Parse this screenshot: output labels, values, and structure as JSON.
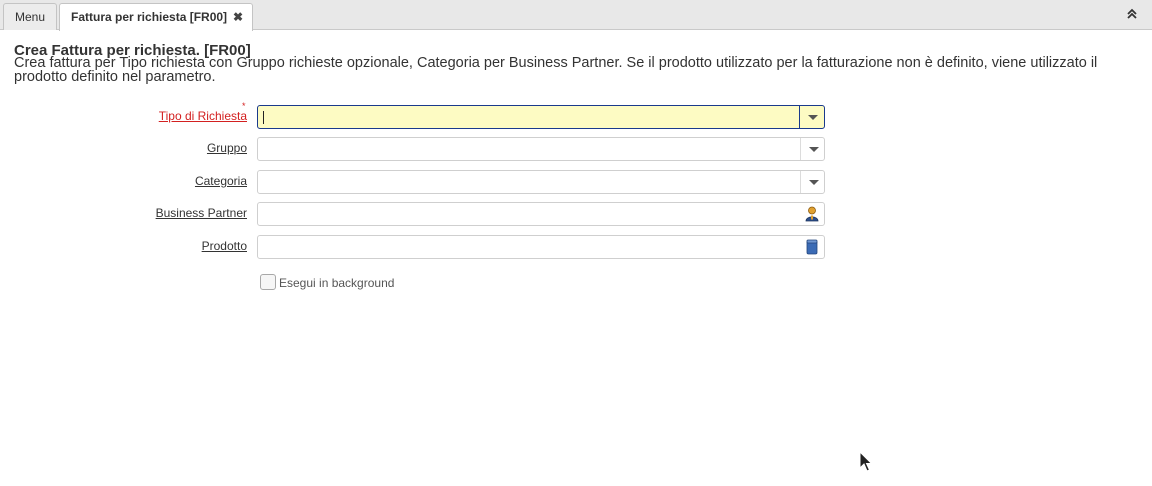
{
  "tabs": {
    "menu_label": "Menu",
    "active_label": "Fattura per richiesta [FR00]",
    "close_glyph": "✖"
  },
  "process": {
    "title": "Crea Fattura per richiesta. [FR00]",
    "description": "Crea fattura per Tipo richiesta con Gruppo richieste opzionale, Categoria per Business Partner. Se il prodotto utilizzato per la fatturazione non è definito, viene utilizzato il prodotto definito nel parametro."
  },
  "form": {
    "tipo_richiesta": {
      "label": "Tipo di Richiesta",
      "required_mark": "*",
      "value": ""
    },
    "gruppo": {
      "label": "Gruppo",
      "value": ""
    },
    "categoria": {
      "label": "Categoria",
      "value": ""
    },
    "business_partner": {
      "label": "Business Partner",
      "value": ""
    },
    "prodotto": {
      "label": "Prodotto",
      "value": ""
    },
    "background": {
      "label": "Esegui in background",
      "checked": false
    }
  },
  "colors": {
    "mandatory_label": "#d32020",
    "active_field_bg": "#fdfbc3",
    "active_field_border": "#1a3a8c"
  },
  "icons": [
    "collapse-up-icon",
    "close-icon",
    "dropdown-icon",
    "business-partner-icon",
    "product-icon",
    "mouse-pointer-icon"
  ]
}
